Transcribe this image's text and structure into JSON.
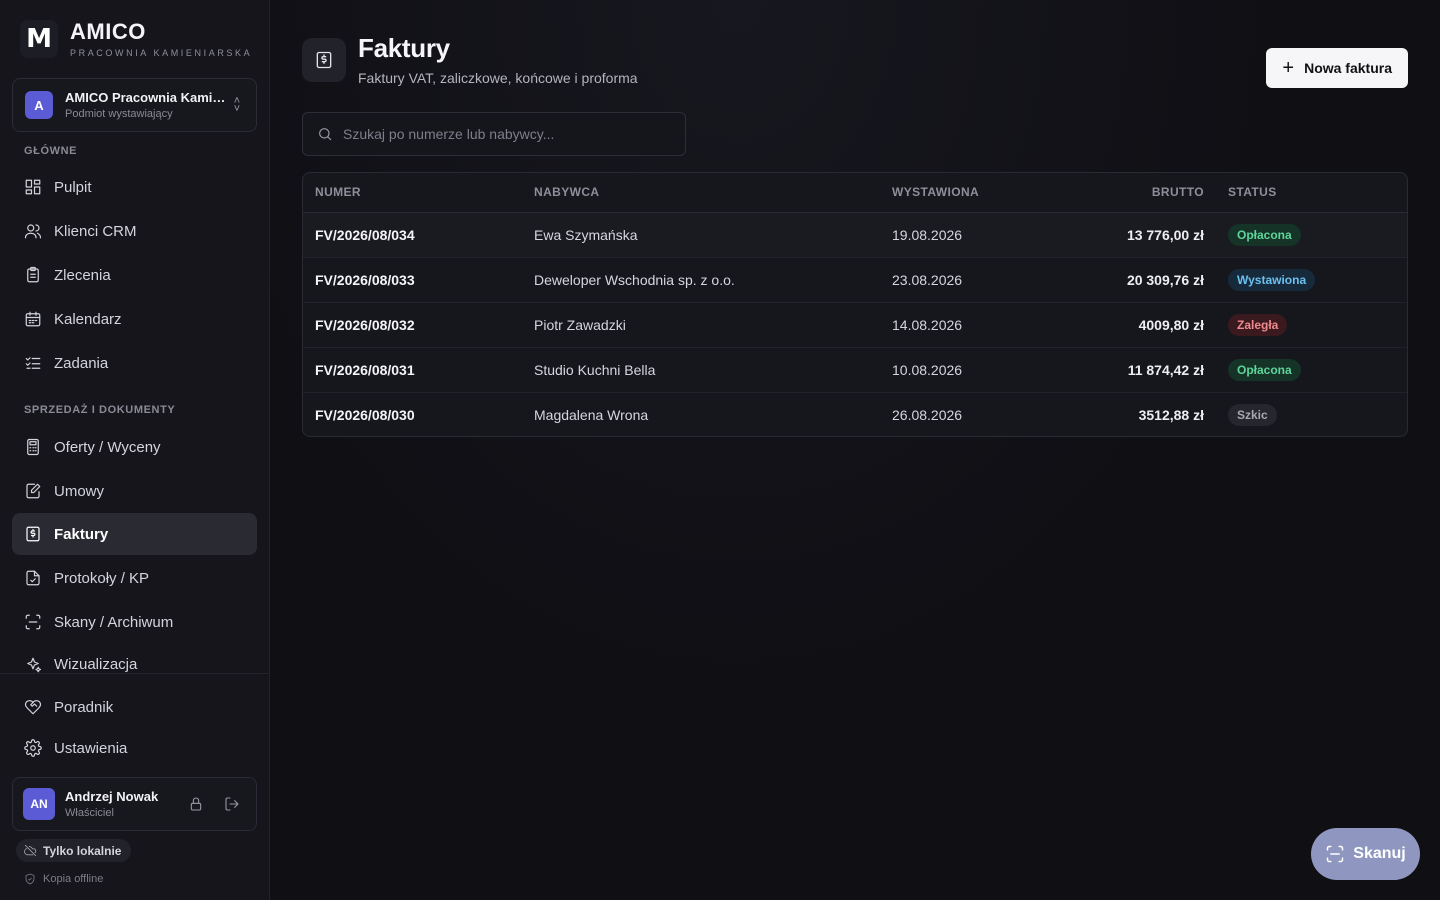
{
  "brand": {
    "logo_letter": "M",
    "name": "AMICO",
    "tagline": "PRACOWNIA KAMIENIARSKA"
  },
  "entity": {
    "avatar": "A",
    "name": "AMICO Pracownia Kamie...",
    "role": "Podmiot wystawiający"
  },
  "sidebar": {
    "section_main": "GŁÓWNE",
    "section_sales": "SPRZEDAŻ I DOKUMENTY",
    "items": [
      {
        "label": "Pulpit",
        "icon": "dashboard-icon"
      },
      {
        "label": "Klienci CRM",
        "icon": "users-icon"
      },
      {
        "label": "Zlecenia",
        "icon": "clipboard-icon"
      },
      {
        "label": "Kalendarz",
        "icon": "calendar-icon"
      },
      {
        "label": "Zadania",
        "icon": "list-check-icon"
      },
      {
        "label": "Oferty / Wyceny",
        "icon": "calculator-icon"
      },
      {
        "label": "Umowy",
        "icon": "contract-icon"
      },
      {
        "label": "Faktury",
        "icon": "invoice-icon",
        "active": true
      },
      {
        "label": "Protokoły / KP",
        "icon": "protocol-icon"
      },
      {
        "label": "Skany / Archiwum",
        "icon": "scan-icon"
      },
      {
        "label": "Wizualizacja",
        "icon": "sparkles-icon"
      },
      {
        "label": "Poradnik",
        "icon": "heart-hand-icon"
      },
      {
        "label": "Ustawienia",
        "icon": "gear-icon"
      }
    ]
  },
  "user": {
    "initials": "AN",
    "name": "Andrzej Nowak",
    "role": "Właściciel"
  },
  "footer": {
    "local_label": "Tylko lokalnie",
    "offline_label": "Kopia offline"
  },
  "header": {
    "title": "Faktury",
    "subtitle": "Faktury VAT, zaliczkowe, końcowe i proforma",
    "new_button": "Nowa faktura"
  },
  "search": {
    "placeholder": "Szukaj po numerze lub nabywcy..."
  },
  "table": {
    "columns": [
      "NUMER",
      "NABYWCA",
      "WYSTAWIONA",
      "BRUTTO",
      "STATUS"
    ],
    "rows": [
      {
        "number": "FV/2026/08/034",
        "buyer": "Ewa Szymańska",
        "date": "19.08.2026",
        "gross": "13 776,00 zł",
        "status": "Opłacona",
        "status_kind": "paid"
      },
      {
        "number": "FV/2026/08/033",
        "buyer": "Deweloper Wschodnia sp. z o.o.",
        "date": "23.08.2026",
        "gross": "20 309,76 zł",
        "status": "Wystawiona",
        "status_kind": "issued"
      },
      {
        "number": "FV/2026/08/032",
        "buyer": "Piotr Zawadzki",
        "date": "14.08.2026",
        "gross": "4009,80 zł",
        "status": "Zaległa",
        "status_kind": "overdue"
      },
      {
        "number": "FV/2026/08/031",
        "buyer": "Studio Kuchni Bella",
        "date": "10.08.2026",
        "gross": "11 874,42 zł",
        "status": "Opłacona",
        "status_kind": "paid"
      },
      {
        "number": "FV/2026/08/030",
        "buyer": "Magdalena Wrona",
        "date": "26.08.2026",
        "gross": "3512,88 zł",
        "status": "Szkic",
        "status_kind": "draft"
      }
    ]
  },
  "scan_button": "Skanuj",
  "colors": {
    "accent": "#5b5bd6",
    "paid": "#5fd49b",
    "issued": "#6cc0f0",
    "overdue": "#f08a8f",
    "draft": "#a8a8b2",
    "scan": "#8f97c0"
  }
}
